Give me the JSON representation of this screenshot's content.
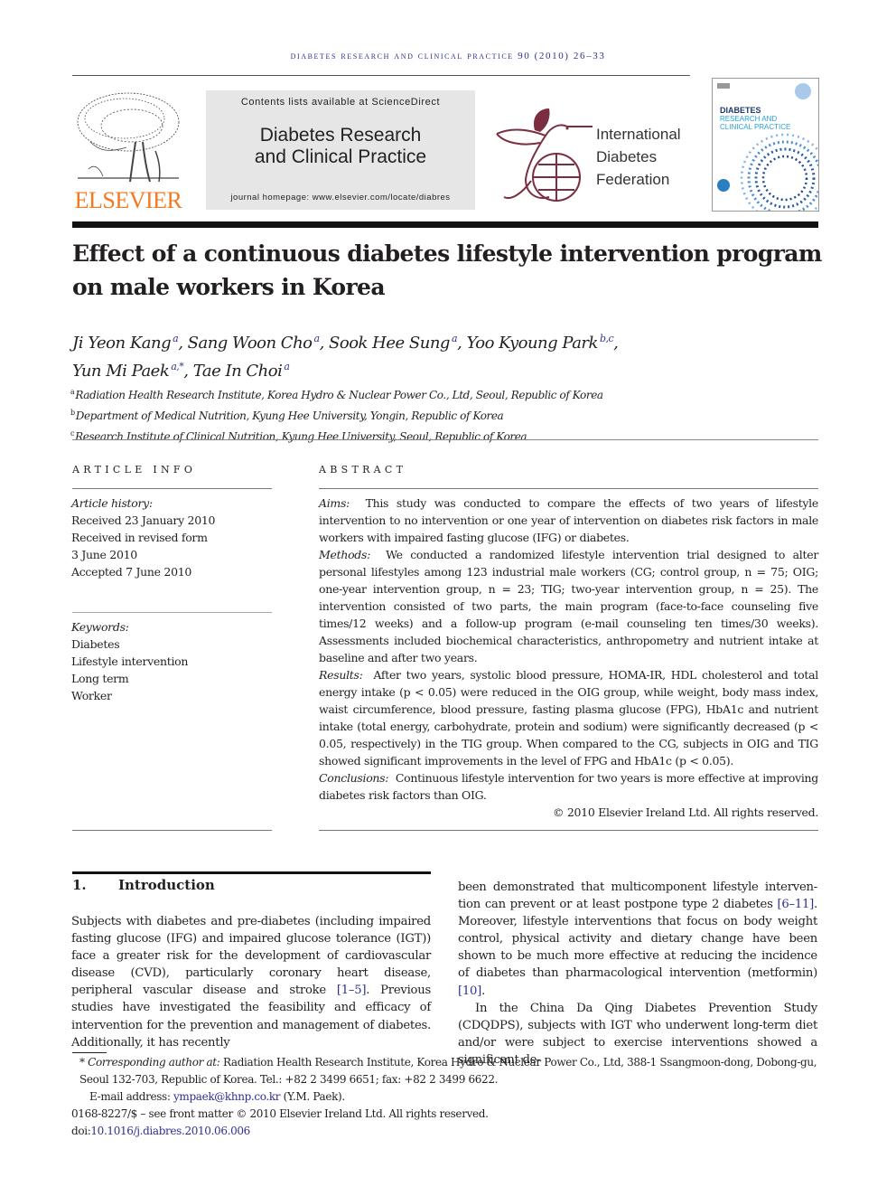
{
  "header": {
    "running_head": "diabetes research and clinical practice 90 (2010) 26–33",
    "publisher_logo_text": "ELSEVIER",
    "contents_line": "Contents lists available at ScienceDirect",
    "journal_title_line1": "Diabetes Research",
    "journal_title_line2": "and Clinical Practice",
    "homepage": "journal homepage: www.elsevier.com/locate/diabres",
    "idf_line1": "International",
    "idf_line2": "Diabetes",
    "idf_line3": "Federation",
    "cover_line1": "DIABETES",
    "cover_line2": "RESEARCH AND",
    "cover_line3": "CLINICAL PRACTICE",
    "colors": {
      "elsevier_orange": "#f47920",
      "idf_maroon": "#7a2e3f",
      "link_blue": "#2e3192"
    }
  },
  "article": {
    "title_line1": "Effect of a continuous diabetes lifestyle intervention program",
    "title_line2": "on male workers in Korea",
    "authors": [
      {
        "name": "Ji Yeon Kang",
        "sup": "a",
        "sep": ", "
      },
      {
        "name": "Sang Woon Cho",
        "sup": "a",
        "sep": ", "
      },
      {
        "name": "Sook Hee Sung",
        "sup": "a",
        "sep": ", "
      },
      {
        "name": "Yoo Kyoung Park",
        "sup": "b,c",
        "sep": ","
      },
      {
        "name": "Yun Mi Paek",
        "sup": "a,*",
        "sep": ", "
      },
      {
        "name": "Tae In Choi",
        "sup": "a",
        "sep": ""
      }
    ],
    "affiliations": [
      {
        "key": "a",
        "text": "Radiation Health Research Institute, Korea Hydro & Nuclear Power Co., Ltd, Seoul, Republic of Korea"
      },
      {
        "key": "b",
        "text": "Department of Medical Nutrition, Kyung Hee University, Yongin, Republic of Korea"
      },
      {
        "key": "c",
        "text": "Research Institute of Clinical Nutrition, Kyung Hee University, Seoul, Republic of Korea"
      }
    ]
  },
  "article_info": {
    "heading": "ARTICLE INFO",
    "history_label": "Article history:",
    "history": [
      "Received 23 January 2010",
      "Received in revised form",
      "3 June 2010",
      "Accepted 7 June 2010"
    ],
    "keywords_label": "Keywords:",
    "keywords": [
      "Diabetes",
      "Lifestyle intervention",
      "Long term",
      "Worker"
    ]
  },
  "abstract": {
    "heading": "ABSTRACT",
    "aims_label": "Aims:",
    "aims": "This study was conducted to compare the effects of two years of lifestyle intervention to no intervention or one year of intervention on diabetes risk factors in male workers with impaired fasting glucose (IFG) or diabetes.",
    "methods_label": "Methods:",
    "methods": "We conducted a randomized lifestyle intervention trial designed to alter personal lifestyles among 123 industrial male workers (CG; control group, n = 75; OIG; one-year intervention group, n = 23; TIG; two-year intervention group, n = 25). The intervention consisted of two parts, the main program (face-to-face counseling five times/12 weeks) and a follow-up program (e-mail counseling ten times/30 weeks). Assessments included biochemical characteristics, anthropometry and nutrient intake at baseline and after two years.",
    "results_label": "Results:",
    "results": "After two years, systolic blood pressure, HOMA-IR, HDL cholesterol and total energy intake (p < 0.05) were reduced in the OIG group, while weight, body mass index, waist circumference, blood pressure, fasting plasma glucose (FPG), HbA1c and nutrient intake (total energy, carbohydrate, protein and sodium) were significantly decreased (p < 0.05, respectively) in the TIG group. When compared to the CG, subjects in OIG and TIG showed significant improvements in the level of FPG and HbA1c (p < 0.05).",
    "conclusions_label": "Conclusions:",
    "conclusions": "Continuous lifestyle intervention for two years is more effective at improving diabetes risk factors than OIG.",
    "copyright": "© 2010 Elsevier Ireland Ltd. All rights reserved."
  },
  "body": {
    "section_number": "1.",
    "section_title": "Introduction",
    "col1_a": "Subjects with diabetes and pre-diabetes (including impaired fasting glucose (IFG) and impaired glucose tolerance (IGT)) face a greater risk for the development of cardiovascular disease (CVD), particularly coronary heart disease, peripheral vascular disease and stroke ",
    "ref_1": "[1–5]",
    "col1_b": ". Previous studies have investigated the feasibility and efficacy of intervention for the prevention and management of diabetes. Additionally, it has recently",
    "col2_a": "been demonstrated that multicomponent lifestyle interven-tion can prevent or at least postpone type 2 diabetes ",
    "ref_2": "[6–11]",
    "col2_b": ". Moreover, lifestyle interventions that focus on body weight control, physical activity and dietary change have been shown to be much more effective at reducing the incidence of diabetes than pharmacological intervention (metformin) ",
    "ref_3": "[10]",
    "col2_c": ".",
    "col2_p2": "In the China Da Qing Diabetes Prevention Study (CDQDPS), subjects with IGT who underwent long-term diet and/or were subject to exercise interventions showed a significant de-"
  },
  "footnotes": {
    "star": "*",
    "corr_label": "Corresponding author at:",
    "corr_text": "Radiation Health Research Institute, Korea Hydro & Nuclear Power Co., Ltd, 388-1 Ssangmoon-dong, Dobong-gu, Seoul 132-703, Republic of Korea. Tel.: +82 2 3499 6651; fax: +82 2 3499 6622.",
    "email_label": "E-mail address: ",
    "email": "ympaek@khnp.co.kr",
    "email_suffix": " (Y.M. Paek).",
    "front_matter": "0168-8227/$ – see front matter © 2010 Elsevier Ireland Ltd. All rights reserved.",
    "doi_label": "doi:",
    "doi": "10.1016/j.diabres.2010.06.006"
  }
}
